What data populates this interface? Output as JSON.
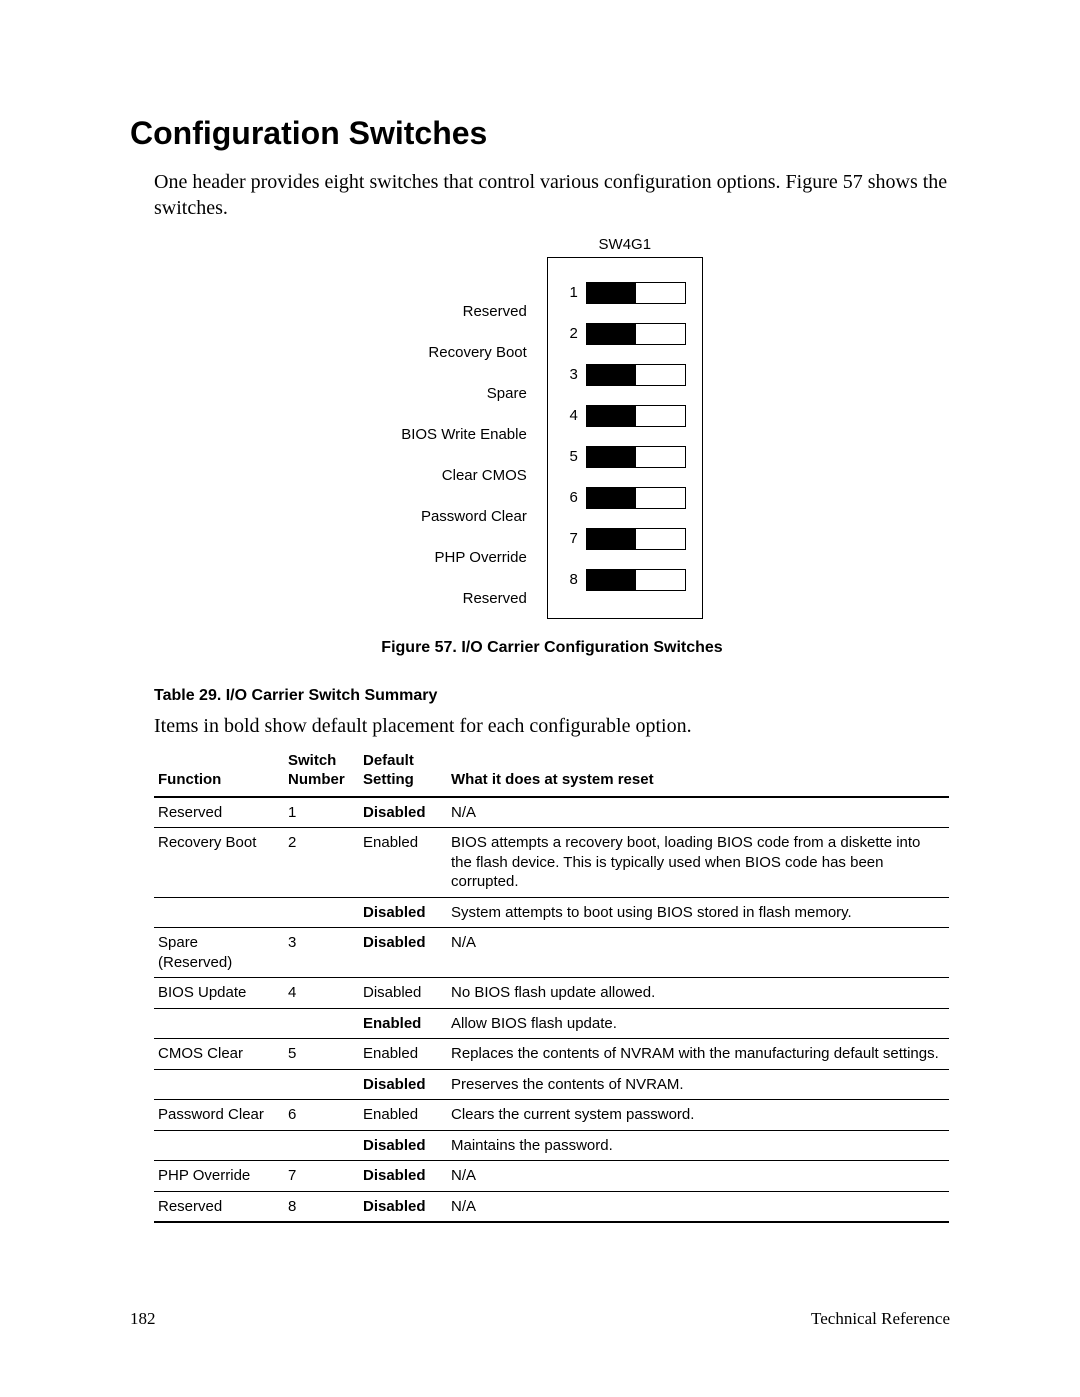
{
  "heading": "Configuration Switches",
  "intro": "One header provides eight switches that control various configuration options.  Figure 57 shows the switches.",
  "figure": {
    "switch_block_label": "SW4G1",
    "switches": [
      {
        "num": "1",
        "label": "Reserved",
        "left_filled": true
      },
      {
        "num": "2",
        "label": "Recovery Boot",
        "left_filled": true
      },
      {
        "num": "3",
        "label": "Spare",
        "left_filled": true
      },
      {
        "num": "4",
        "label": "BIOS Write Enable",
        "left_filled": true
      },
      {
        "num": "5",
        "label": "Clear CMOS",
        "left_filled": true
      },
      {
        "num": "6",
        "label": "Password Clear",
        "left_filled": true
      },
      {
        "num": "7",
        "label": "PHP Override",
        "left_filled": true
      },
      {
        "num": "8",
        "label": "Reserved",
        "left_filled": true
      }
    ],
    "caption": "Figure 57.  I/O Carrier Configuration Switches"
  },
  "table": {
    "caption": "Table 29.    I/O Carrier Switch Summary",
    "intro": "Items in bold show default placement for each configurable option.",
    "headers": {
      "function": "Function",
      "number_l1": "Switch",
      "number_l2": "Number",
      "setting_l1": "Default",
      "setting_l2": "Setting",
      "desc": "What it does at system reset"
    },
    "rows": [
      {
        "function": "Reserved",
        "number": "1",
        "setting": "Disabled",
        "setting_bold": true,
        "desc": "N/A"
      },
      {
        "function": "Recovery Boot",
        "number": "2",
        "setting": "Enabled",
        "setting_bold": false,
        "desc": "BIOS attempts a recovery boot, loading BIOS code from a diskette into the flash device.  This is typically used when BIOS code has been corrupted."
      },
      {
        "function": "",
        "number": "",
        "setting": "Disabled",
        "setting_bold": true,
        "desc": "System attempts to boot using BIOS stored in flash memory."
      },
      {
        "function": "Spare (Reserved)",
        "number": "3",
        "setting": "Disabled",
        "setting_bold": true,
        "desc": "N/A"
      },
      {
        "function": "BIOS Update",
        "number": "4",
        "setting": "Disabled",
        "setting_bold": false,
        "desc": "No BIOS flash update allowed."
      },
      {
        "function": "",
        "number": "",
        "setting": "Enabled",
        "setting_bold": true,
        "desc": "Allow BIOS flash update."
      },
      {
        "function": "CMOS Clear",
        "number": "5",
        "setting": "Enabled",
        "setting_bold": false,
        "desc": "Replaces the contents of NVRAM with the manufacturing default settings."
      },
      {
        "function": "",
        "number": "",
        "setting": "Disabled",
        "setting_bold": true,
        "desc": "Preserves the contents of NVRAM."
      },
      {
        "function": "Password Clear",
        "number": "6",
        "setting": "Enabled",
        "setting_bold": false,
        "desc": "Clears the current system password."
      },
      {
        "function": "",
        "number": "",
        "setting": "Disabled",
        "setting_bold": true,
        "desc": "Maintains the password."
      },
      {
        "function": "PHP Override",
        "number": "7",
        "setting": "Disabled",
        "setting_bold": true,
        "desc": "N/A"
      },
      {
        "function": "Reserved",
        "number": "8",
        "setting": "Disabled",
        "setting_bold": true,
        "desc": "N/A"
      }
    ]
  },
  "footer": {
    "page": "182",
    "ref": "Technical Reference"
  }
}
